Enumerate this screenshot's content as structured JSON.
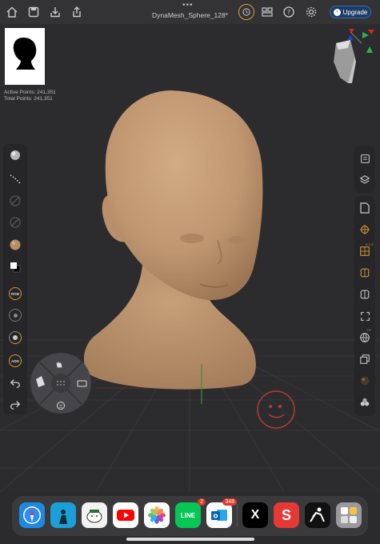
{
  "topbar": {
    "doc_title": "DynaMesh_Sphere_128*",
    "upgrade_label": "Upgrade",
    "more_label": "•••"
  },
  "stats": {
    "active_points": "Active Points: 241,351",
    "total_points": "Total Points: 241,351"
  },
  "left_toolbar": {
    "rgb_label": "RGB",
    "add_label": "ADD"
  },
  "right_toolbar": {
    "xyz_label": "X Y Z",
    "lp_label": "LP"
  },
  "dock": {
    "apps": [
      {
        "name": "Safari",
        "color": "#1e88e5"
      },
      {
        "name": "Kindle",
        "color": "#1a9fd9"
      },
      {
        "name": "Sheep app",
        "color": "#f2f2f2"
      },
      {
        "name": "YouTube",
        "color": "#ffffff"
      },
      {
        "name": "Photos",
        "color": "#ffffff"
      },
      {
        "name": "LINE",
        "color": "#06c755",
        "label": "LINE",
        "badge": "2"
      },
      {
        "name": "Outlook",
        "color": "#ffffff",
        "badge": "348"
      },
      {
        "name": "X",
        "color": "#000000",
        "label": "X"
      },
      {
        "name": "S app",
        "color": "#e53935",
        "label": "S"
      },
      {
        "name": "ZBrush",
        "color": "#111111"
      },
      {
        "name": "App folder",
        "color": "#9a9a9e"
      }
    ]
  },
  "colors": {
    "accent": "#d89a34",
    "clay": "#c9a07a",
    "background": "#2c2c2e"
  }
}
